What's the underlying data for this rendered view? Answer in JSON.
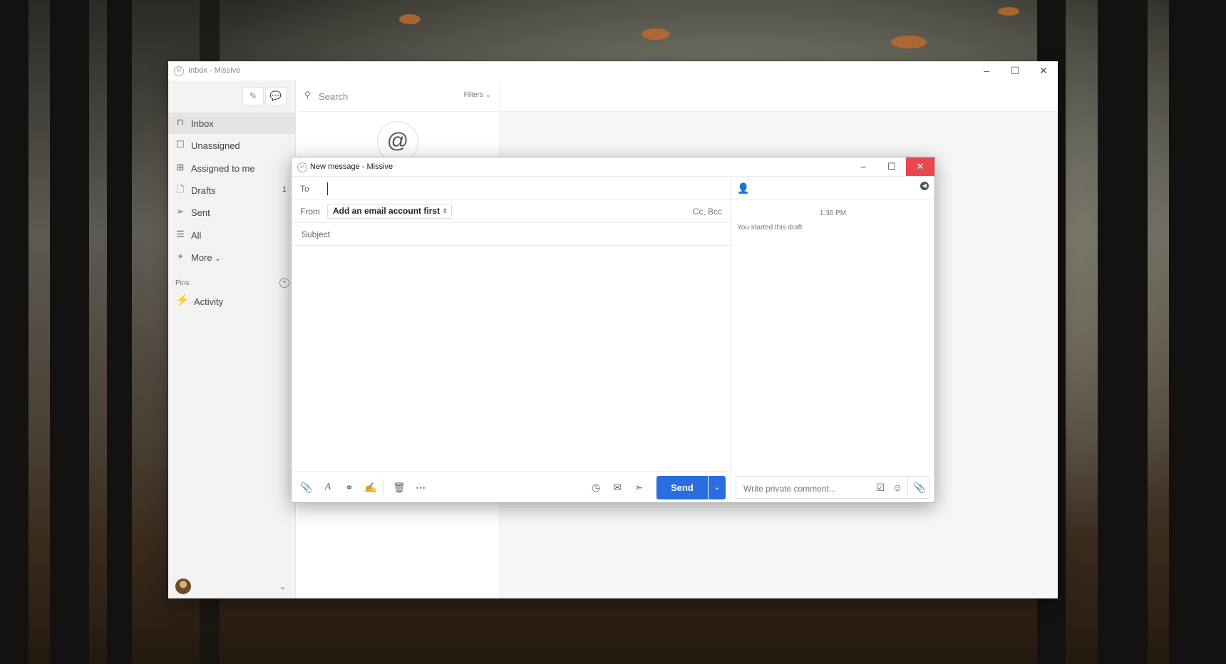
{
  "main_window": {
    "title": "Inbox - Missive",
    "controls": {
      "minimize": "–",
      "maximize": "☐",
      "close": "✕"
    }
  },
  "sidebar": {
    "compose_icon": "pencil-icon",
    "chat_icon": "chat-bubbles-icon",
    "items": [
      {
        "label": "Inbox",
        "icon": "inbox-icon",
        "active": true
      },
      {
        "label": "Unassigned",
        "icon": "checkbox-icon"
      },
      {
        "label": "Assigned to me",
        "icon": "plus-square-icon"
      },
      {
        "label": "Drafts",
        "icon": "file-icon",
        "count": "1"
      },
      {
        "label": "Sent",
        "icon": "paper-plane-icon"
      },
      {
        "label": "All",
        "icon": "archive-icon"
      },
      {
        "label": "More",
        "icon": "tag-icon"
      }
    ],
    "more_chevron": "⌄",
    "pins_label": "Pins",
    "pins_add": "+",
    "pinned": [
      {
        "label": "Activity",
        "icon": "lightning-icon",
        "icon_color": "#e0a800"
      }
    ],
    "account_chevron": "⌄"
  },
  "list": {
    "search_placeholder": "Search",
    "filters_label": "Filters ⌄",
    "empty_icon": "@"
  },
  "compose": {
    "title": "New message - Missive",
    "controls": {
      "minimize": "–",
      "maximize": "☐",
      "close": "✕"
    },
    "to_label": "To",
    "to_value": "",
    "from_label": "From",
    "from_value": "Add an email account first",
    "from_updown": "⇕",
    "cc_bcc": "Cc, Bcc",
    "subject_placeholder": "Subject",
    "send_label": "Send",
    "send_more": "⌄",
    "accent": "#2a6ddf",
    "close_color": "#e8474f"
  },
  "comments": {
    "time": "1:36 PM",
    "event": "You started this draft",
    "placeholder": "Write private comment..."
  }
}
